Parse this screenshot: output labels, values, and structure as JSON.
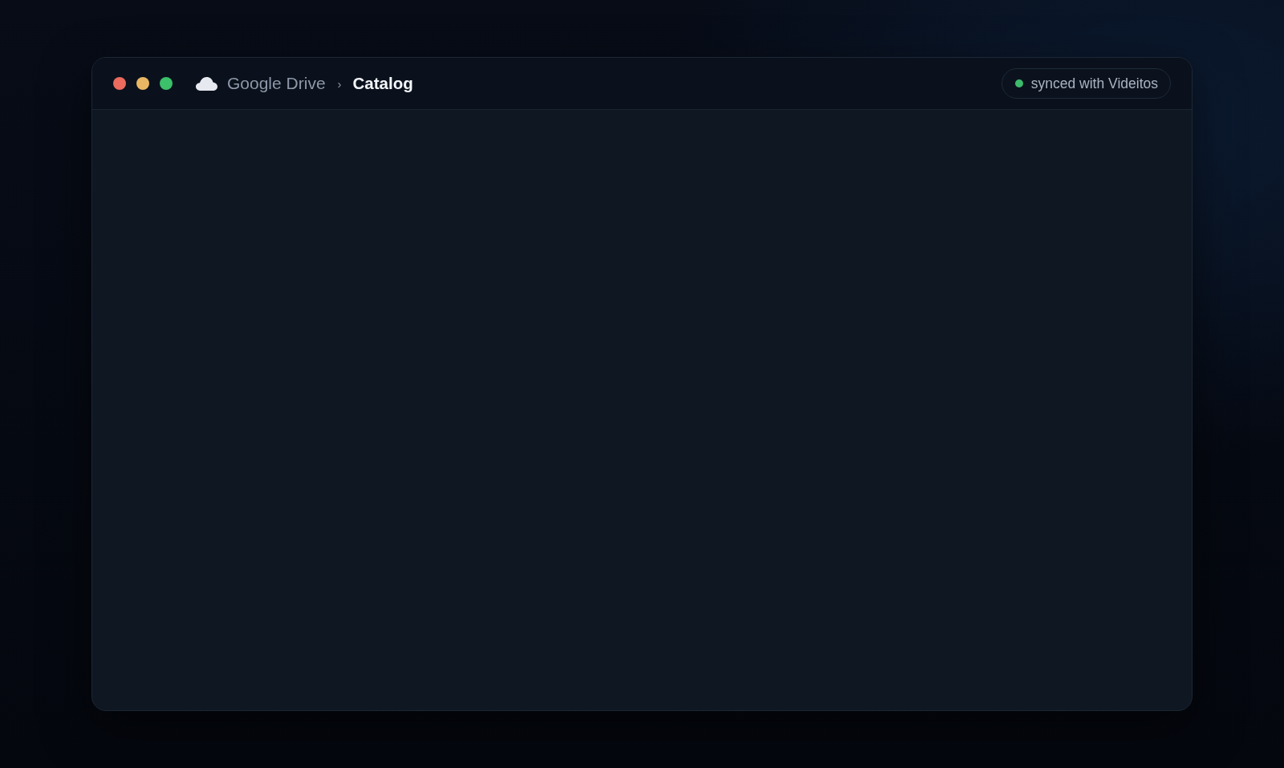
{
  "window": {
    "controls": [
      {
        "color": "#ec6a5e"
      },
      {
        "color": "#e9b764"
      },
      {
        "color": "#3cc06a"
      }
    ],
    "breadcrumb": {
      "items": [
        {
          "label": "Google Drive",
          "selected": false
        },
        {
          "label": "Catalog",
          "selected": true
        }
      ],
      "separator": "›"
    },
    "status": {
      "text": "synced with Videitos",
      "color": "#3dbb6c"
    }
  }
}
